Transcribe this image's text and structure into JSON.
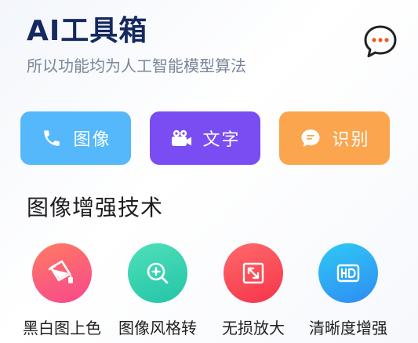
{
  "header": {
    "title": "AI工具箱",
    "subtitle": "所以功能均为人工智能模型算法"
  },
  "actions": [
    {
      "label": "图像",
      "icon": "phone-icon",
      "color": "#55b8fb"
    },
    {
      "label": "文字",
      "icon": "video-camera-icon",
      "color": "#7a4df3"
    },
    {
      "label": "识别",
      "icon": "chat-bubble-icon",
      "color": "#fba64f"
    }
  ],
  "section": {
    "heading": "图像增强技术"
  },
  "tools": [
    {
      "label": "黑白图上色",
      "icon": "paint-bucket-icon"
    },
    {
      "label": "图像风格转",
      "icon": "zoom-in-icon"
    },
    {
      "label": "无损放大",
      "icon": "expand-icon"
    },
    {
      "label": "清晰度增强",
      "icon": "hd-icon"
    }
  ],
  "colors": {
    "title": "#14295e",
    "subtitle": "#7a8699",
    "chat_icon_accent": "#f05a22"
  }
}
